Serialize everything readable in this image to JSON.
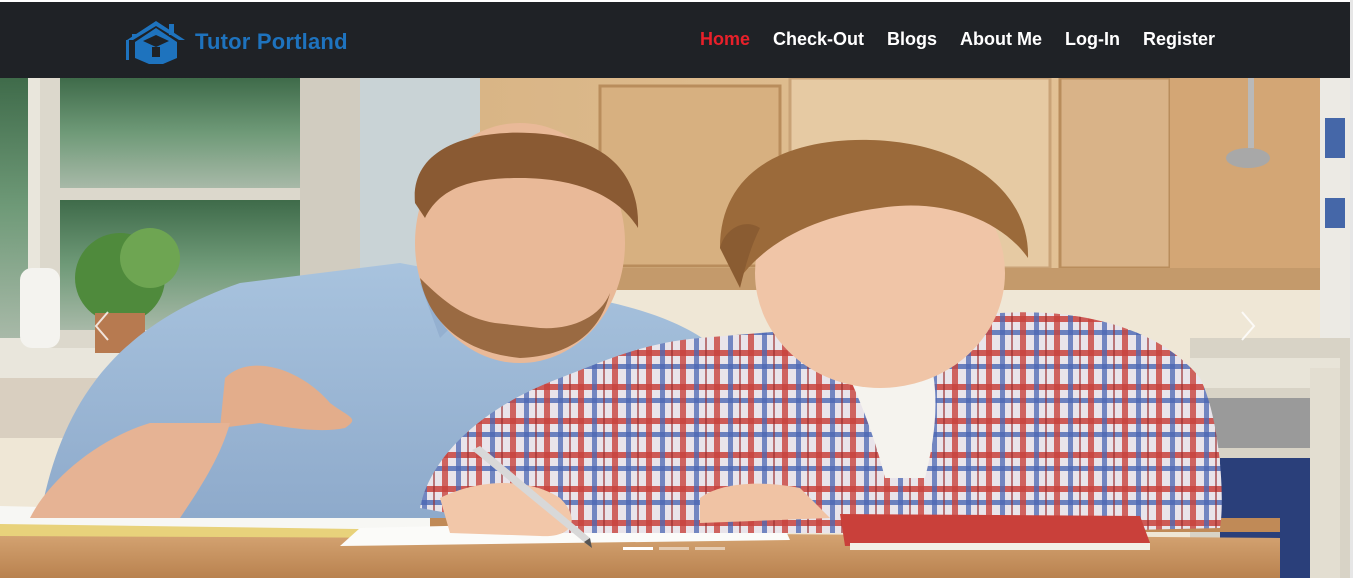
{
  "brand": {
    "name": "Tutor Portland",
    "color": "#1e73be",
    "icon": "house-graduation-cap-icon"
  },
  "nav": {
    "background": "#1f2226",
    "active_color": "#e8202a",
    "items": [
      {
        "label": "Home",
        "active": true
      },
      {
        "label": "Check-Out",
        "active": false
      },
      {
        "label": "Blogs",
        "active": false
      },
      {
        "label": "About Me",
        "active": false
      },
      {
        "label": "Log-In",
        "active": false
      },
      {
        "label": "Register",
        "active": false
      }
    ]
  },
  "carousel": {
    "slide_count": 3,
    "active_slide": 1,
    "prev_icon": "chevron-left-icon",
    "next_icon": "chevron-right-icon"
  }
}
